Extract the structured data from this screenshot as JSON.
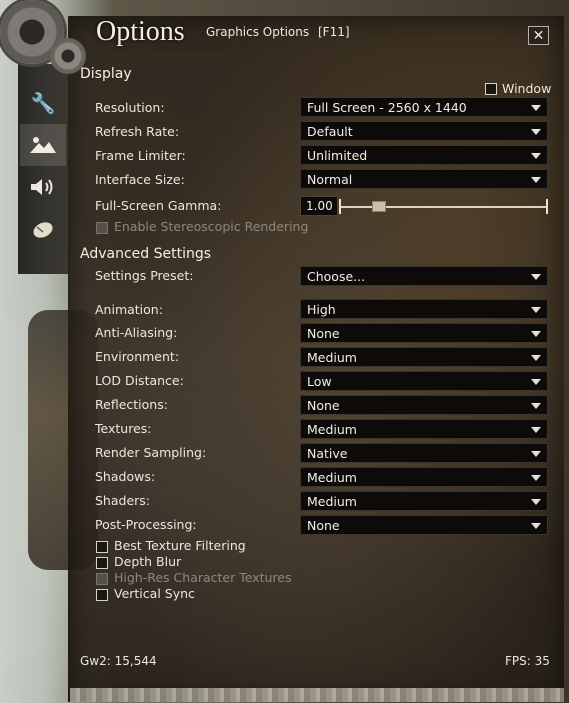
{
  "window": {
    "title": "Options",
    "subtitle": "Graphics Options",
    "hotkey": "[F11]",
    "close_label": "✕"
  },
  "tabs": [
    {
      "icon": "wrench-icon",
      "glyph": "🔧"
    },
    {
      "icon": "mountains-icon",
      "glyph": "▲"
    },
    {
      "icon": "speaker-icon",
      "glyph": "🔊"
    },
    {
      "icon": "mouse-icon",
      "glyph": "🖱"
    }
  ],
  "display": {
    "heading": "Display",
    "window_checkbox_label": "Window",
    "resolution": {
      "label": "Resolution:",
      "value": "Full Screen - 2560 x 1440"
    },
    "refresh_rate": {
      "label": "Refresh Rate:",
      "value": "Default"
    },
    "frame_limiter": {
      "label": "Frame Limiter:",
      "value": "Unlimited"
    },
    "interface_size": {
      "label": "Interface Size:",
      "value": "Normal"
    },
    "gamma": {
      "label": "Full-Screen Gamma:",
      "value": "1.00"
    },
    "stereo_label": "Enable Stereoscopic Rendering"
  },
  "advanced": {
    "heading": "Advanced Settings",
    "preset": {
      "label": "Settings Preset:",
      "value": "Choose..."
    },
    "animation": {
      "label": "Animation:",
      "value": "High"
    },
    "anti_aliasing": {
      "label": "Anti-Aliasing:",
      "value": "None"
    },
    "environment": {
      "label": "Environment:",
      "value": "Medium"
    },
    "lod_distance": {
      "label": "LOD Distance:",
      "value": "Low"
    },
    "reflections": {
      "label": "Reflections:",
      "value": "None"
    },
    "textures": {
      "label": "Textures:",
      "value": "Medium"
    },
    "render_sampling": {
      "label": "Render Sampling:",
      "value": "Native"
    },
    "shadows": {
      "label": "Shadows:",
      "value": "Medium"
    },
    "shaders": {
      "label": "Shaders:",
      "value": "Medium"
    },
    "post_processing": {
      "label": "Post-Processing:",
      "value": "None"
    },
    "best_texture_filtering": "Best Texture Filtering",
    "depth_blur": "Depth Blur",
    "high_res_textures": "High-Res Character Textures",
    "vertical_sync": "Vertical Sync"
  },
  "footer": {
    "build": "Gw2: 15,544",
    "fps": "FPS: 35"
  }
}
